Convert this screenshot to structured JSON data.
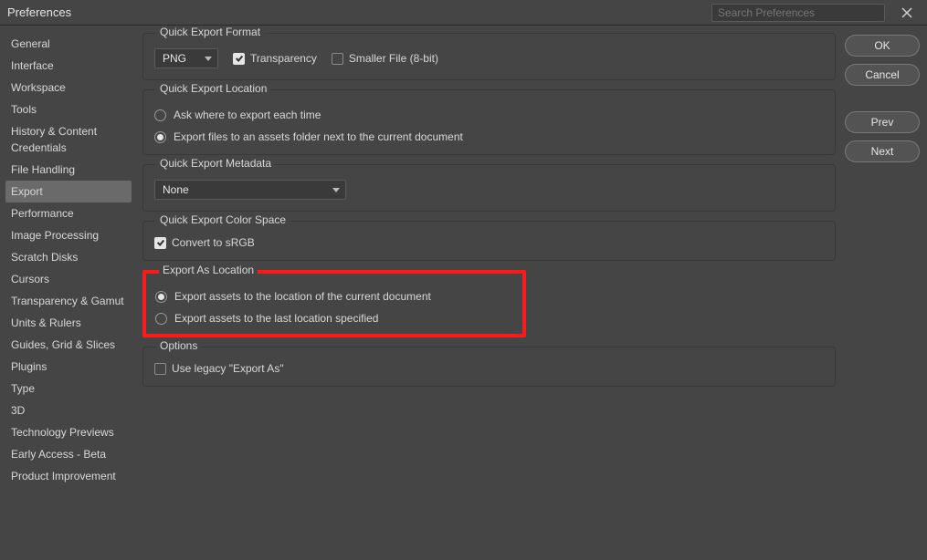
{
  "window": {
    "title": "Preferences",
    "search_placeholder": "Search Preferences"
  },
  "sidebar": {
    "items": [
      "General",
      "Interface",
      "Workspace",
      "Tools",
      "History & Content Credentials",
      "File Handling",
      "Export",
      "Performance",
      "Image Processing",
      "Scratch Disks",
      "Cursors",
      "Transparency & Gamut",
      "Units & Rulers",
      "Guides, Grid & Slices",
      "Plugins",
      "Type",
      "3D",
      "Technology Previews",
      "Early Access - Beta",
      "Product Improvement"
    ],
    "active_index": 6
  },
  "actions": {
    "ok": "OK",
    "cancel": "Cancel",
    "prev": "Prev",
    "next": "Next"
  },
  "sections": {
    "format": {
      "legend": "Quick Export Format",
      "format_value": "PNG",
      "transparency_label": "Transparency",
      "transparency_checked": true,
      "smaller_label": "Smaller File (8-bit)",
      "smaller_checked": false
    },
    "location": {
      "legend": "Quick Export Location",
      "opt_ask": "Ask where to export each time",
      "opt_assets": "Export files to an assets folder next to the current document",
      "selected": "assets"
    },
    "metadata": {
      "legend": "Quick Export Metadata",
      "value": "None"
    },
    "colorspace": {
      "legend": "Quick Export Color Space",
      "convert_label": "Convert to sRGB",
      "convert_checked": true
    },
    "exportas": {
      "legend": "Export As Location",
      "opt_current": "Export assets to the location of the current document",
      "opt_last": "Export assets to the last location specified",
      "selected": "current"
    },
    "options": {
      "legend": "Options",
      "legacy_label": "Use legacy \"Export As\"",
      "legacy_checked": false
    }
  }
}
